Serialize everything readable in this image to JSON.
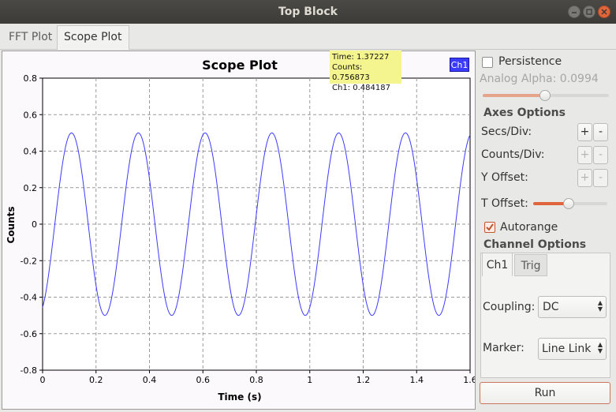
{
  "window": {
    "title": "Top Block"
  },
  "tabs": [
    {
      "label": "FFT Plot",
      "active": false
    },
    {
      "label": "Scope Plot",
      "active": true
    }
  ],
  "chart_data": {
    "type": "line",
    "title": "Scope Plot",
    "xlabel": "Time (s)",
    "ylabel": "Counts",
    "xlim": [
      0,
      1.6
    ],
    "ylim": [
      -0.8,
      0.8
    ],
    "x_ticks": [
      "0",
      "0.2",
      "0.4",
      "0.6",
      "0.8",
      "1",
      "1.2",
      "1.4",
      "1.6"
    ],
    "y_ticks": [
      "0.8",
      "0.6",
      "0.4",
      "0.2",
      "0",
      "-0.2",
      "-0.4",
      "-0.6",
      "-0.8"
    ],
    "grid": true,
    "legend": "top-right",
    "series": [
      {
        "name": "Ch1",
        "color": "#3b3bff",
        "amplitude": 0.5,
        "frequency_hz": 4,
        "phase_rad": -1.15
      }
    ]
  },
  "tooltip": {
    "time": "Time: 1.37227",
    "counts": "Counts: 0.756873",
    "ch1": "Ch1: 0.484187"
  },
  "controls": {
    "persistence_label": "Persistence",
    "persistence_checked": false,
    "alpha_label": "Analog Alpha: 0.0994",
    "alpha_value": 0.6,
    "axes_options": "Axes Options",
    "secs_div": "Secs/Div:",
    "counts_div": "Counts/Div:",
    "y_offset": "Y Offset:",
    "t_offset": "T Offset:",
    "t_offset_value": 0.55,
    "plus": "+",
    "minus": "-",
    "autorange_label": "Autorange",
    "autorange_checked": true,
    "channel_options": "Channel Options",
    "ch_tab": "Ch1",
    "trig_tab": "Trig",
    "coupling_label": "Coupling:",
    "coupling_value": "DC",
    "marker_label": "Marker:",
    "marker_value": "Line Link",
    "run_label": "Run"
  }
}
